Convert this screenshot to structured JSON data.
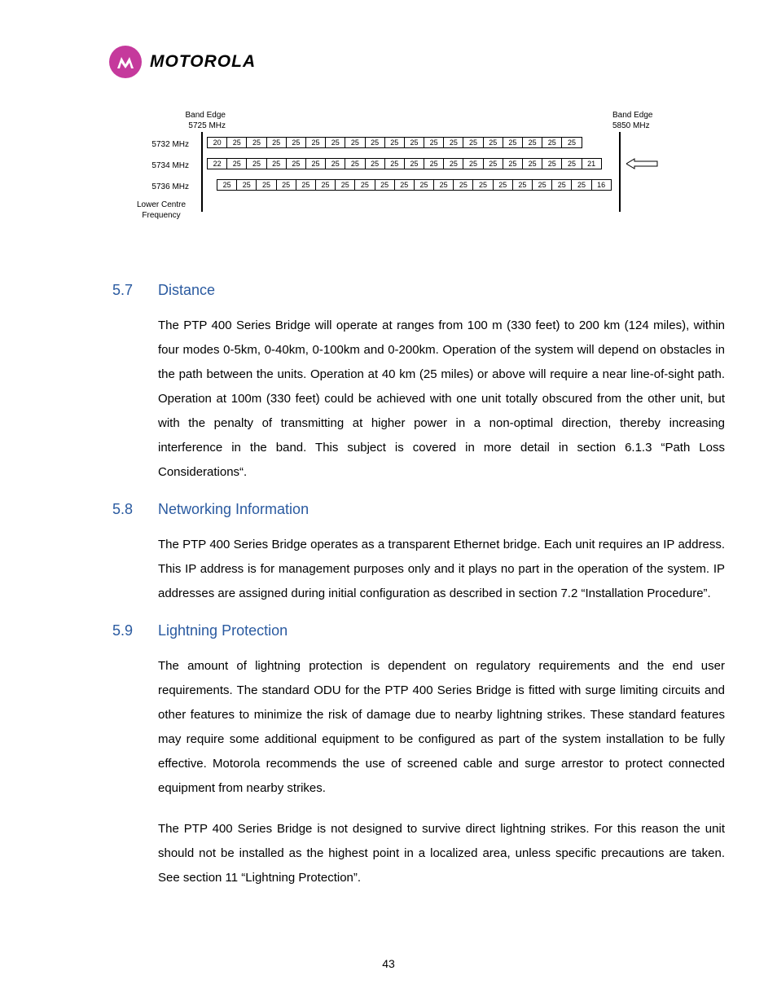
{
  "brand": "MOTOROLA",
  "page_number": "43",
  "chart_data": {
    "type": "table",
    "band_edge_left_label": "Band Edge",
    "band_edge_left_freq": "5725 MHz",
    "band_edge_right_label": "Band Edge",
    "band_edge_right_freq": "5850 MHz",
    "lower_centre_label": "Lower Centre\nFrequency",
    "rows": [
      {
        "label": "5732 MHz",
        "values": [
          "20",
          "25",
          "25",
          "25",
          "25",
          "25",
          "25",
          "25",
          "25",
          "25",
          "25",
          "25",
          "25",
          "25",
          "25",
          "25",
          "25",
          "25",
          "25"
        ]
      },
      {
        "label": "5734 MHz",
        "values": [
          "22",
          "25",
          "25",
          "25",
          "25",
          "25",
          "25",
          "25",
          "25",
          "25",
          "25",
          "25",
          "25",
          "25",
          "25",
          "25",
          "25",
          "25",
          "25",
          "21"
        ]
      },
      {
        "label": "5736 MHz",
        "values": [
          "25",
          "25",
          "25",
          "25",
          "25",
          "25",
          "25",
          "25",
          "25",
          "25",
          "25",
          "25",
          "25",
          "25",
          "25",
          "25",
          "25",
          "25",
          "25",
          "16"
        ]
      }
    ]
  },
  "sections": {
    "s1": {
      "num": "5.7",
      "title": "Distance",
      "body": "The PTP 400 Series Bridge will operate at ranges from 100 m (330 feet) to 200 km (124 miles), within four modes 0-5km, 0-40km, 0-100km and 0-200km. Operation of the system will depend on obstacles in the path between the units. Operation at 40 km (25 miles) or above will require a near line-of-sight path. Operation at 100m (330 feet) could be achieved with one unit totally obscured from the other unit, but with the penalty of transmitting at higher power in a non-optimal direction, thereby increasing interference in the band. This subject is covered in more detail in section 6.1.3 “Path Loss Considerations“."
    },
    "s2": {
      "num": "5.8",
      "title": "Networking Information",
      "body": "The PTP 400 Series Bridge operates as a transparent Ethernet bridge. Each unit requires an IP address. This IP address is for management purposes only and it plays no part in the operation of the system. IP addresses are assigned during initial configuration as described in section 7.2 “Installation Procedure”."
    },
    "s3": {
      "num": "5.9",
      "title": "Lightning Protection",
      "body1": "The amount of lightning protection is dependent on regulatory requirements and the end user requirements. The standard ODU for the PTP 400 Series Bridge is fitted with surge limiting circuits and other features to minimize the risk of damage due to nearby lightning strikes. These standard features may require some additional equipment to be configured as part of the system installation to be fully effective. Motorola recommends the use of screened cable and surge arrestor to protect connected equipment from nearby strikes.",
      "body2": "The PTP 400 Series Bridge is not designed to survive direct lightning strikes. For this reason the unit should not be installed as the highest point in a localized area, unless specific precautions are taken. See section 11 “Lightning Protection”."
    }
  }
}
